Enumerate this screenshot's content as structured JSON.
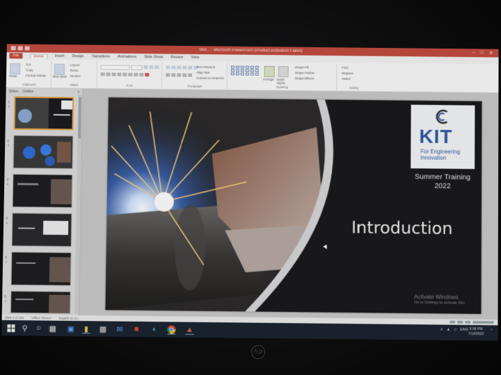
{
  "window": {
    "title": "Wer... - Microsoft PowerPoint (Product Activation Failed)",
    "controls": [
      "minimize-icon",
      "maximize-icon",
      "close-icon"
    ]
  },
  "ribbon": {
    "tabs": [
      "File",
      "Home",
      "Insert",
      "Design",
      "Transitions",
      "Animations",
      "Slide Show",
      "Review",
      "View"
    ],
    "active_tab": "Home",
    "clipboard": {
      "paste": "Paste",
      "cut": "Cut",
      "copy": "Copy",
      "format_painter": "Format Painter",
      "label": "Clipboard"
    },
    "slides": {
      "new_slide": "New Slide",
      "layout": "Layout",
      "reset": "Reset",
      "section": "Section",
      "label": "Slides"
    },
    "font": {
      "label": "Font"
    },
    "paragraph": {
      "text_direction": "Text Direction",
      "align_text": "Align Text",
      "convert": "Convert to SmartArt",
      "label": "Paragraph"
    },
    "drawing": {
      "arrange": "Arrange",
      "quick_styles": "Quick Styles",
      "shape_fill": "Shape Fill",
      "shape_outline": "Shape Outline",
      "shape_effects": "Shape Effects",
      "label": "Drawing"
    },
    "editing": {
      "find": "Find",
      "replace": "Replace",
      "select": "Select",
      "label": "Editing"
    }
  },
  "pane": {
    "tabs": [
      "Slides",
      "Outline"
    ],
    "close": "x",
    "slide_numbers": [
      "1",
      "2",
      "3",
      "4",
      "5",
      "6"
    ]
  },
  "slide": {
    "logo_text": "KIT",
    "logo_sub": "For Engineering Innovation",
    "summer_line1": "Summer Training",
    "summer_line2": "2022",
    "title": "Introduction",
    "watermark_line1": "Activate Windows",
    "watermark_line2": "Go to Settings to activate Win"
  },
  "status": {
    "slide_count": "Slide 1 of 101",
    "theme": "\"Office Theme\"",
    "language": "English (U.S.)"
  },
  "taskbar": {
    "icons": [
      "windows-start-icon",
      "search-icon",
      "cortana-icon",
      "task-view-icon",
      "app-icon",
      "file-explorer-icon",
      "store-icon",
      "mail-icon",
      "app-red-icon",
      "edge-icon",
      "chrome-icon",
      "powerpoint-icon"
    ],
    "tray_language": "ENG",
    "clock_time": "6:08 PM",
    "clock_date": "7/14/2022"
  },
  "colors": {
    "title_bar": "#c84a3d",
    "logo_blue": "#2b5aa8",
    "slide_dark": "#1a1a1c",
    "taskbar": "#1b2330"
  },
  "device_logo": "hp"
}
